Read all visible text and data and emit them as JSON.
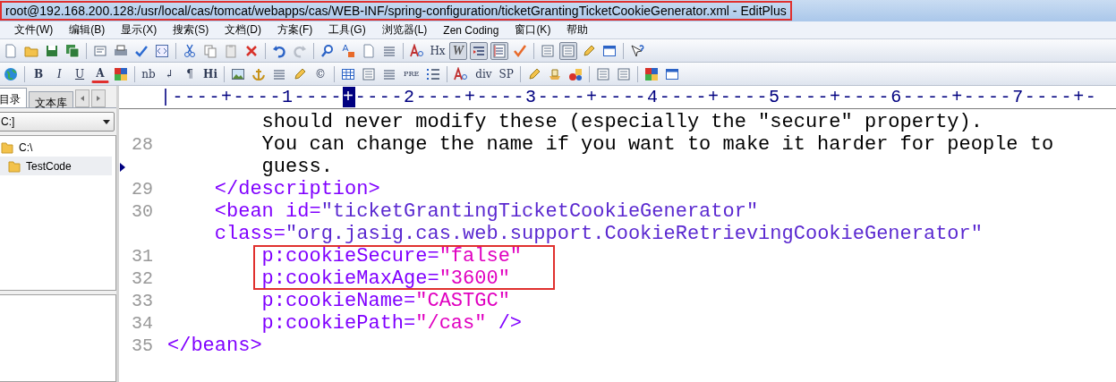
{
  "window": {
    "title": "root@192.168.200.128:/usr/local/cas/tomcat/webapps/cas/WEB-INF/spring-configuration/ticketGrantingTicketCookieGenerator.xml - EditPlus",
    "highlighted": true
  },
  "menu": [
    "文件(W)",
    "编辑(B)",
    "显示(X)",
    "搜索(S)",
    "文档(D)",
    "方案(F)",
    "工具(G)",
    "浏览器(L)",
    "Zen Coding",
    "窗口(K)",
    "帮助"
  ],
  "toolbars": [
    [
      {
        "kind": "icon"
      },
      {
        "kind": "icon"
      },
      {
        "kind": "icon"
      },
      {
        "kind": "icon"
      },
      {
        "kind": "sep"
      },
      {
        "kind": "icon"
      },
      {
        "kind": "icon"
      },
      {
        "kind": "icon"
      },
      {
        "kind": "icon"
      },
      {
        "kind": "sep"
      },
      {
        "kind": "icon"
      },
      {
        "kind": "icon"
      },
      {
        "kind": "icon"
      },
      {
        "kind": "icon"
      },
      {
        "kind": "sep"
      },
      {
        "kind": "icon"
      },
      {
        "kind": "icon"
      },
      {
        "kind": "sep"
      },
      {
        "kind": "icon"
      },
      {
        "kind": "icon"
      },
      {
        "kind": "icon"
      },
      {
        "kind": "icon"
      },
      {
        "kind": "sep"
      },
      {
        "kind": "icon"
      },
      {
        "kind": "text",
        "label": "Hx"
      },
      {
        "kind": "text",
        "label": "W",
        "pressed": true
      },
      {
        "kind": "icon",
        "pressed": true
      },
      {
        "kind": "icon",
        "pressed": true
      },
      {
        "kind": "icon"
      },
      {
        "kind": "sep"
      },
      {
        "kind": "icon"
      },
      {
        "kind": "icon",
        "pressed": true
      },
      {
        "kind": "icon"
      },
      {
        "kind": "icon"
      },
      {
        "kind": "sep"
      },
      {
        "kind": "icon"
      }
    ],
    [
      {
        "kind": "icon"
      },
      {
        "kind": "sep"
      },
      {
        "kind": "text",
        "label": "B"
      },
      {
        "kind": "text",
        "label": "I"
      },
      {
        "kind": "text",
        "label": "U"
      },
      {
        "kind": "text",
        "label": "A"
      },
      {
        "kind": "icon"
      },
      {
        "kind": "sep"
      },
      {
        "kind": "text",
        "label": "nb"
      },
      {
        "kind": "text",
        "label": "↲"
      },
      {
        "kind": "text",
        "label": "¶"
      },
      {
        "kind": "text",
        "label": "Hi"
      },
      {
        "kind": "sep"
      },
      {
        "kind": "icon"
      },
      {
        "kind": "icon"
      },
      {
        "kind": "icon"
      },
      {
        "kind": "icon"
      },
      {
        "kind": "text",
        "label": "©"
      },
      {
        "kind": "sep"
      },
      {
        "kind": "icon"
      },
      {
        "kind": "icon"
      },
      {
        "kind": "icon"
      },
      {
        "kind": "text",
        "label": "PRE"
      },
      {
        "kind": "icon"
      },
      {
        "kind": "sep"
      },
      {
        "kind": "icon"
      },
      {
        "kind": "text",
        "label": "div"
      },
      {
        "kind": "text",
        "label": "SP"
      },
      {
        "kind": "sep"
      },
      {
        "kind": "icon"
      },
      {
        "kind": "icon"
      },
      {
        "kind": "icon"
      },
      {
        "kind": "sep"
      },
      {
        "kind": "icon"
      },
      {
        "kind": "icon"
      },
      {
        "kind": "sep"
      },
      {
        "kind": "icon"
      },
      {
        "kind": "icon"
      }
    ]
  ],
  "sidebar": {
    "tabs": [
      {
        "label": "目录",
        "selected": true
      },
      {
        "label": "文本库",
        "selected": false
      }
    ],
    "drive": "C:]",
    "tree": [
      {
        "label": "C:\\",
        "children": [
          {
            "label": "TestCode",
            "selected": true
          }
        ]
      }
    ]
  },
  "ruler": {
    "before": "|----+----1----",
    "cursor": "+",
    "after": "----2----+----3----+----4----+----5----+----6----+----7----+-"
  },
  "lines": [
    {
      "tokens": [
        {
          "kind": "plain",
          "text": "        should never modify these (especially the \"secure\" property)."
        }
      ]
    },
    {
      "number": "28",
      "tokens": [
        {
          "kind": "plain",
          "text": "        You can change the name if you want to make it harder for people to"
        }
      ]
    },
    {
      "wrap": true,
      "tokens": [
        {
          "kind": "plain",
          "text": "        guess."
        }
      ]
    },
    {
      "number": "29",
      "tokens": [
        {
          "kind": "tag",
          "text": "    </description>"
        }
      ]
    },
    {
      "number": "30",
      "tokens": [
        {
          "kind": "tag",
          "text": "    <bean id="
        },
        {
          "kind": "value",
          "text": "\"ticketGrantingTicketCookieGenerator\""
        }
      ]
    },
    {
      "tokens": [
        {
          "kind": "tag",
          "text": "    class="
        },
        {
          "kind": "value",
          "text": "\"org.jasig.cas.web.support.CookieRetrievingCookieGenerator\""
        }
      ]
    },
    {
      "number": "31",
      "boxed": true,
      "tokens": [
        {
          "kind": "tag",
          "text": "        p:cookieSecure="
        },
        {
          "kind": "string",
          "text": "\"false\""
        }
      ]
    },
    {
      "number": "32",
      "boxed": true,
      "tokens": [
        {
          "kind": "tag",
          "text": "        p:cookieMaxAge="
        },
        {
          "kind": "string",
          "text": "\"3600\""
        }
      ]
    },
    {
      "number": "33",
      "tokens": [
        {
          "kind": "tag",
          "text": "        p:cookieName="
        },
        {
          "kind": "string",
          "text": "\"CASTGC\""
        }
      ]
    },
    {
      "number": "34",
      "tokens": [
        {
          "kind": "tag",
          "text": "        p:cookiePath="
        },
        {
          "kind": "string",
          "text": "\"/cas\""
        },
        {
          "kind": "tag",
          "text": " />"
        }
      ]
    },
    {
      "number": "35",
      "tokens": [
        {
          "kind": "tag",
          "text": "</beans>"
        }
      ]
    }
  ]
}
